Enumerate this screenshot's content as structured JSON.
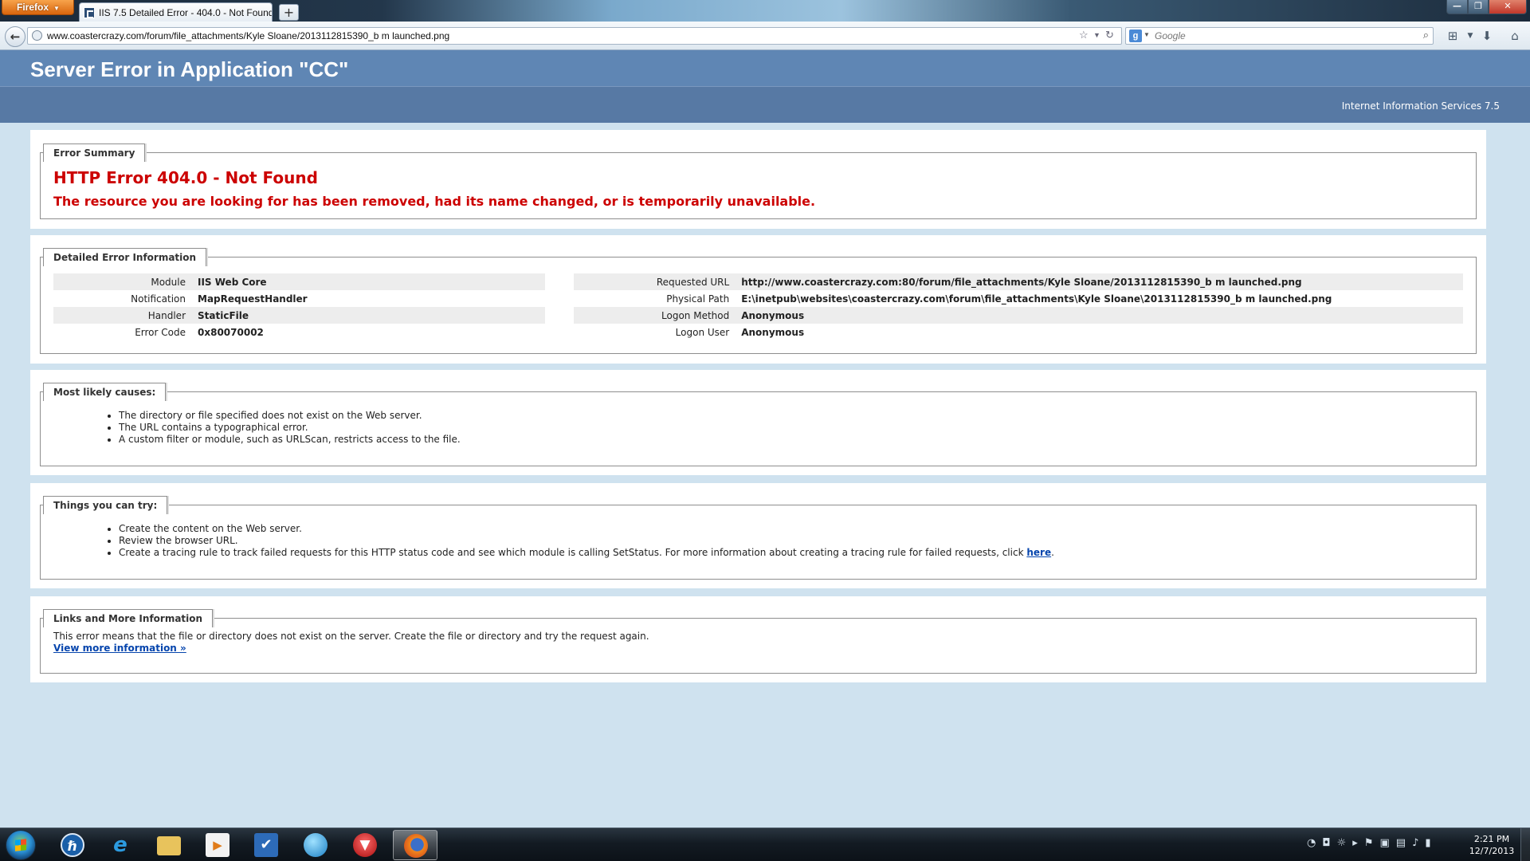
{
  "browser": {
    "menu_button": "Firefox",
    "tab_title": "IIS 7.5 Detailed Error - 404.0 - Not Found",
    "new_tab": "+",
    "url": "www.coastercrazy.com/forum/file_attachments/Kyle Sloane/2013112815390_b m launched.png",
    "search_placeholder": "Google",
    "search_engine_icon": "google-icon"
  },
  "page": {
    "title": "Server Error in Application \"CC\"",
    "server_software": "Internet Information Services 7.5",
    "error_summary": {
      "legend": "Error Summary",
      "heading": "HTTP Error 404.0 - Not Found",
      "description": "The resource you are looking for has been removed, had its name changed, or is temporarily unavailable."
    },
    "detailed_info": {
      "legend": "Detailed Error Information",
      "left_rows": [
        {
          "label": "Module",
          "value": "IIS Web Core"
        },
        {
          "label": "Notification",
          "value": "MapRequestHandler"
        },
        {
          "label": "Handler",
          "value": "StaticFile"
        },
        {
          "label": "Error Code",
          "value": "0x80070002"
        }
      ],
      "right_rows": [
        {
          "label": "Requested URL",
          "value": "http://www.coastercrazy.com:80/forum/file_attachments/Kyle Sloane/2013112815390_b m launched.png"
        },
        {
          "label": "Physical Path",
          "value": "E:\\inetpub\\websites\\coastercrazy.com\\forum\\file_attachments\\Kyle Sloane\\2013112815390_b m launched.png"
        },
        {
          "label": "Logon Method",
          "value": "Anonymous"
        },
        {
          "label": "Logon User",
          "value": "Anonymous"
        }
      ]
    },
    "causes": {
      "legend": "Most likely causes:",
      "items": [
        "The directory or file specified does not exist on the Web server.",
        "The URL contains a typographical error.",
        "A custom filter or module, such as URLScan, restricts access to the file."
      ]
    },
    "try": {
      "legend": "Things you can try:",
      "items": [
        "Create the content on the Web server.",
        "Review the browser URL.",
        "Create a tracing rule to track failed requests for this HTTP status code and see which module is calling SetStatus. For more information about creating a tracing rule for failed requests, click"
      ],
      "link": "here",
      "link_suffix": "."
    },
    "links": {
      "legend": "Links and More Information",
      "text": "This error means that the file or directory does not exist on the server. Create the file or directory and try the request again.",
      "more_link": "View more information »"
    }
  },
  "taskbar": {
    "apps": [
      "hp-icon",
      "internet-explorer-icon",
      "file-explorer-icon",
      "media-player-icon",
      "task-app-icon",
      "globe-app-icon",
      "red-app-icon",
      "firefox-icon"
    ],
    "active_app": "firefox-icon",
    "time": "2:21 PM",
    "date": "12/7/2013"
  },
  "colors": {
    "header_bg": "#5f86b4",
    "subheader_bg": "#5779a4",
    "page_bg": "#cfe2ef",
    "error_red": "#cc0000",
    "link_blue": "#0645ad"
  }
}
